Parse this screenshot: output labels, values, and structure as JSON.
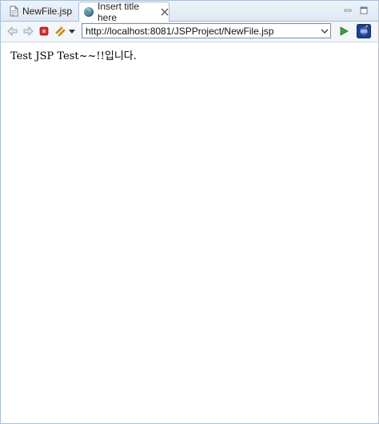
{
  "tabs": [
    {
      "label": "NewFile.jsp",
      "icon": "jsp-file-icon",
      "active": false
    },
    {
      "label": "Insert title here",
      "icon": "globe-icon",
      "active": true
    }
  ],
  "toolbar": {
    "url": "http://localhost:8081/JSPProject/NewFile.jsp",
    "icons": [
      "back-arrow-icon",
      "forward-arrow-icon",
      "stop-icon",
      "refresh-icon",
      "dropdown-icon",
      "go-icon",
      "eclipse-icon"
    ]
  },
  "page": {
    "body_text": "Test JSP Test~~!!입니다."
  },
  "colors": {
    "border": "#a9bfd6",
    "tab_background": "#dfe8f3",
    "toolbar_background": "#f2f6fb",
    "go_green": "#3aa335",
    "stop_red": "#d92a2a"
  }
}
